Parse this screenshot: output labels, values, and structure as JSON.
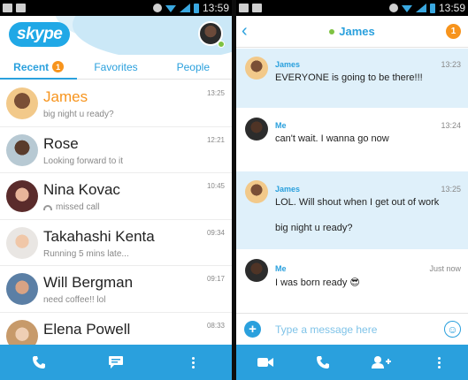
{
  "status_bar": {
    "time": "13:59"
  },
  "left": {
    "app_logo": "skype",
    "tabs": [
      {
        "label": "Recent",
        "badge": "1",
        "active": true
      },
      {
        "label": "Favorites"
      },
      {
        "label": "People"
      }
    ],
    "conversations": [
      {
        "name": "James",
        "preview": "big night u ready?",
        "time": "13:25",
        "unread": true
      },
      {
        "name": "Rose",
        "preview": "Looking forward to it",
        "time": "12:21"
      },
      {
        "name": "Nina Kovac",
        "preview": "missed call",
        "time": "10:45",
        "icon": "missed-call-icon"
      },
      {
        "name": "Takahashi Kenta",
        "preview": "Running 5 mins late...",
        "time": "09:34"
      },
      {
        "name": "Will Bergman",
        "preview": "need coffee!! lol",
        "time": "09:17"
      },
      {
        "name": "Elena Powell",
        "preview": "",
        "time": "08:33"
      }
    ],
    "bottom_icons": [
      "phone-icon",
      "chat-icon",
      "more-icon"
    ]
  },
  "right": {
    "contact_name": "James",
    "unread_badge": "1",
    "messages": [
      {
        "sender": "James",
        "time": "13:23",
        "text": "EVERYONE is going to be there!!!",
        "from": "them"
      },
      {
        "sender": "Me",
        "time": "13:24",
        "text": "can't wait. I wanna go now",
        "from": "me"
      },
      {
        "sender": "James",
        "time": "13:25",
        "text": "LOL. Will shout when I get out of work",
        "text2": "big night u ready?",
        "from": "them"
      },
      {
        "sender": "Me",
        "time": "Just now",
        "text": "I was born ready 😎",
        "from": "me"
      }
    ],
    "composer_placeholder": "Type a message here",
    "bottom_icons": [
      "video-icon",
      "phone-icon",
      "add-person-icon",
      "more-icon"
    ]
  }
}
